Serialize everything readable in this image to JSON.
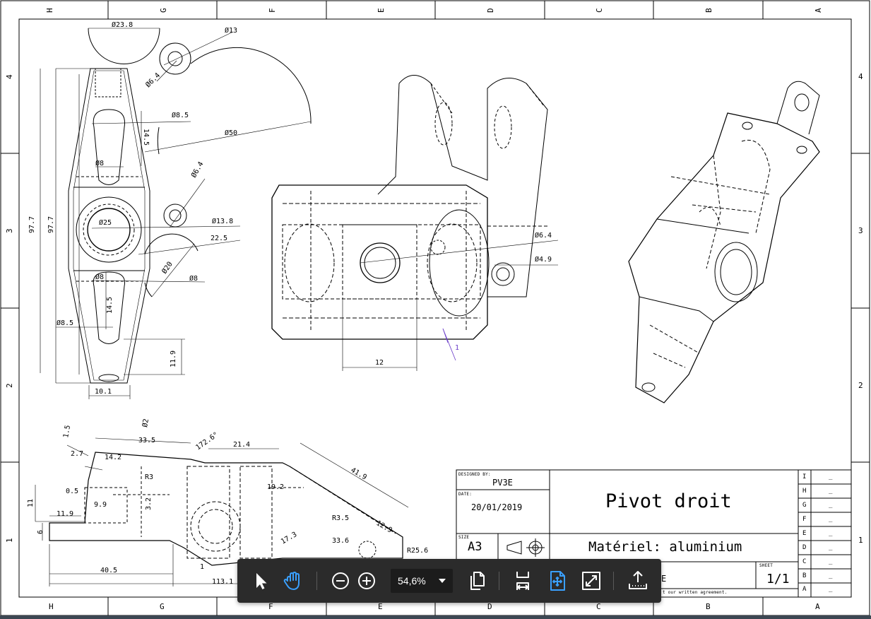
{
  "border": {
    "columns_top": [
      "H",
      "G",
      "F",
      "E",
      "D",
      "C",
      "B",
      "A"
    ],
    "columns_bottom": [
      "H",
      "G",
      "F",
      "E",
      "D",
      "C",
      "B",
      "A"
    ],
    "rows": [
      "4",
      "3",
      "2",
      "1"
    ]
  },
  "dimensions": {
    "top_view": [
      "Ø23.8",
      "Ø13",
      "Ø6.4",
      "Ø8.5",
      "Ø50",
      "14.5",
      "Ø8",
      "Ø6.4",
      "Ø25",
      "Ø13.8",
      "22.5",
      "Ø20",
      "Ø8",
      "Ø8",
      "14.5",
      "97.7",
      "97.7",
      "Ø8.5",
      "11.9",
      "10.1"
    ],
    "front_view": [
      "Ø6.4",
      "Ø4.9",
      "12",
      "1"
    ],
    "side_view": [
      "1.5",
      "Ø2",
      "33.5",
      "21.4",
      "172.6°",
      "2.7",
      "14.2",
      "R3",
      "0.5",
      "9.9",
      "11",
      "11.9",
      "6",
      "3.2",
      "R3.5",
      "41.9",
      "12.9",
      "33.6",
      "R25.6",
      "19.2",
      "17.3",
      "40.5",
      "113.1",
      "1"
    ]
  },
  "title_block": {
    "designed_by_label": "DESIGNED BY:",
    "designed_by": "PV3E",
    "date_label": "DATE:",
    "date": "20/01/2019",
    "size_label": "SIZE",
    "size": "A3",
    "title": "Pivot droit",
    "material": "Matériel: aluminium",
    "partial_name": "E",
    "sheet_label": "SHEET",
    "sheet": "1/1",
    "agreement": "t our written agreement.",
    "revisions": [
      {
        "letter": "I",
        "value": "_"
      },
      {
        "letter": "H",
        "value": "_"
      },
      {
        "letter": "G",
        "value": "_"
      },
      {
        "letter": "F",
        "value": "_"
      },
      {
        "letter": "E",
        "value": "_"
      },
      {
        "letter": "D",
        "value": "_"
      },
      {
        "letter": "C",
        "value": "_"
      },
      {
        "letter": "B",
        "value": "_"
      },
      {
        "letter": "A",
        "value": "_"
      }
    ]
  },
  "toolbar": {
    "select_tool": "pointer-icon",
    "hand_tool": "hand-icon",
    "zoom_out": "zoom-out-icon",
    "zoom_in": "zoom-in-icon",
    "zoom_level": "54,6%",
    "page_view": "copy-pages-icon",
    "fit_width": "fit-width-icon",
    "fit_page": "fit-page-icon",
    "fullscreen": "fullscreen-icon",
    "share": "share-icon",
    "active_color": "#3aa0ff",
    "icon_color": "#ffffff",
    "background": "#2b2b2b"
  }
}
